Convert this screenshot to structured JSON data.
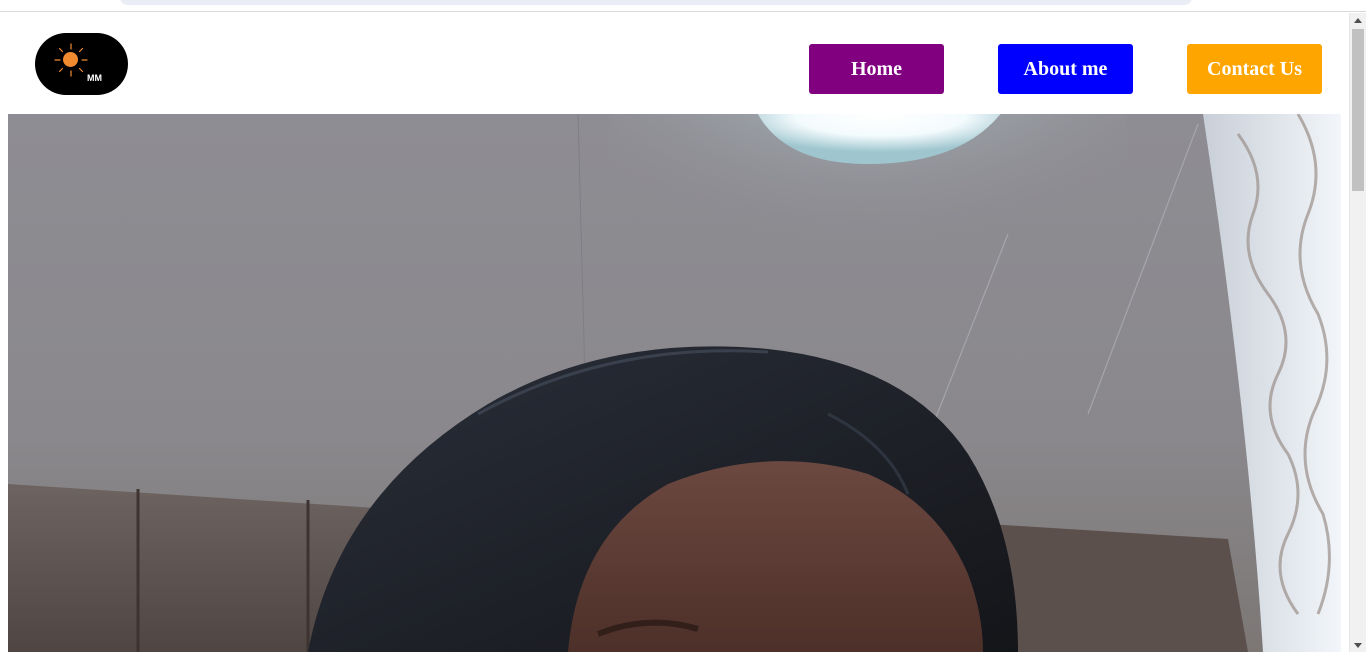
{
  "logo": {
    "text": "MM",
    "icon": "sun-icon",
    "background": "#000000",
    "sun_color": "#f28a30"
  },
  "nav": {
    "home_label": "Home",
    "about_label": "About me",
    "contact_label": "Contact Us",
    "home_color": "#800080",
    "about_color": "#0000ff",
    "contact_color": "#ffa500"
  },
  "hero": {
    "image": "portrait-photo"
  }
}
